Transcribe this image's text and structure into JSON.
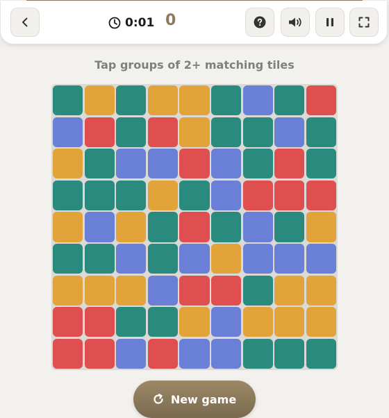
{
  "header": {
    "timer": "0:01",
    "score": "0"
  },
  "instruction": "Tap groups of 2+ matching tiles",
  "new_game_label": "New game",
  "colors": {
    "T": "#2a8a7e",
    "Y": "#e3a33b",
    "B": "#6a7fd6",
    "R": "#e04f50"
  },
  "board": {
    "rows": 9,
    "cols": 9,
    "tiles": [
      [
        "T",
        "Y",
        "T",
        "Y",
        "Y",
        "T",
        "B",
        "T",
        "R"
      ],
      [
        "B",
        "R",
        "T",
        "R",
        "Y",
        "T",
        "T",
        "B",
        "T"
      ],
      [
        "Y",
        "T",
        "B",
        "B",
        "R",
        "B",
        "T",
        "R",
        "T"
      ],
      [
        "T",
        "T",
        "T",
        "Y",
        "T",
        "B",
        "R",
        "R",
        "R"
      ],
      [
        "Y",
        "B",
        "Y",
        "T",
        "R",
        "T",
        "B",
        "T",
        "Y"
      ],
      [
        "T",
        "T",
        "B",
        "T",
        "B",
        "Y",
        "B",
        "B",
        "B"
      ],
      [
        "Y",
        "Y",
        "Y",
        "B",
        "R",
        "R",
        "T",
        "Y",
        "Y"
      ],
      [
        "R",
        "R",
        "T",
        "T",
        "Y",
        "B",
        "Y",
        "Y",
        "Y"
      ],
      [
        "R",
        "R",
        "B",
        "R",
        "B",
        "B",
        "T",
        "T",
        "T"
      ]
    ]
  }
}
